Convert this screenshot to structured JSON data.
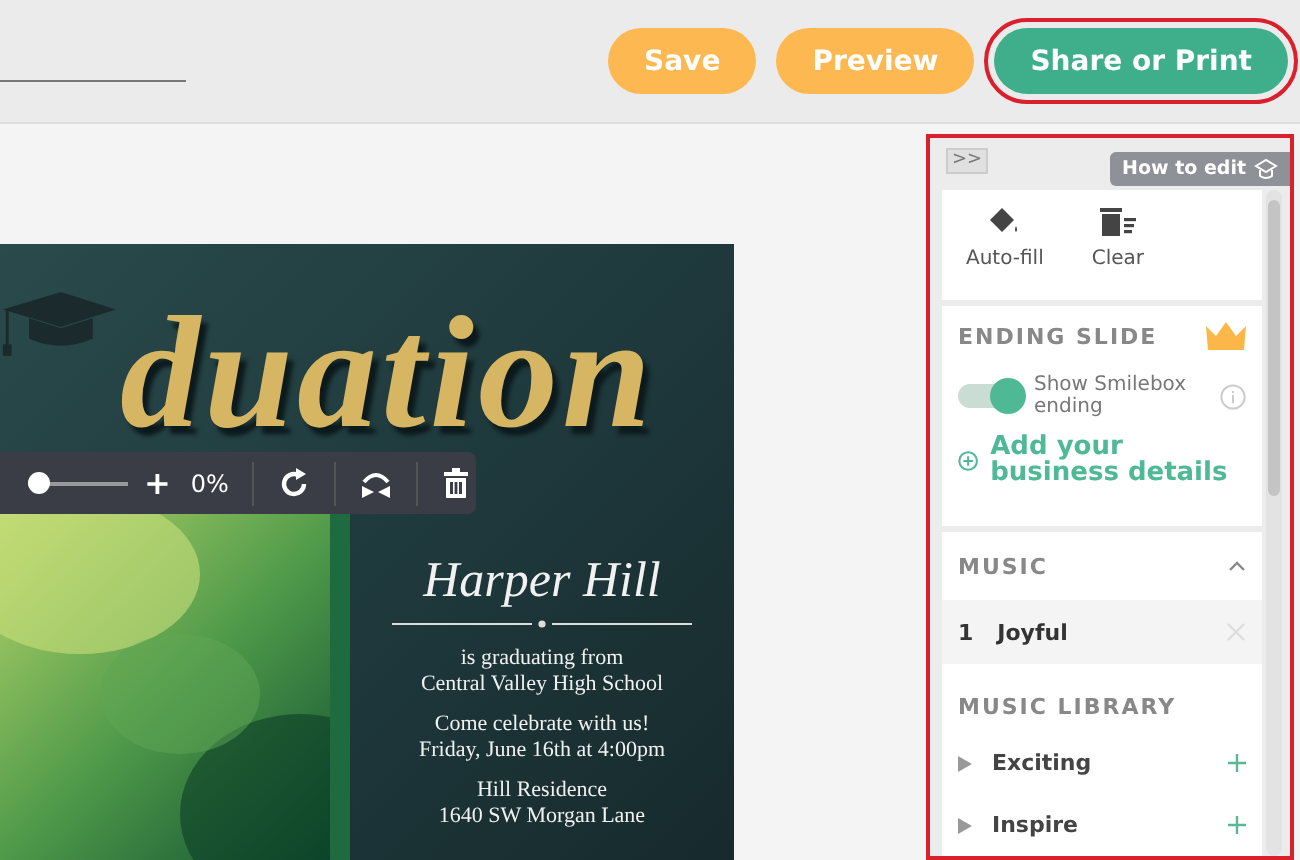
{
  "top_bar": {
    "buttons": [
      {
        "label": "Save",
        "kind": "secondary",
        "highlighted": false
      },
      {
        "label": "Preview",
        "kind": "secondary",
        "highlighted": false
      },
      {
        "label": "Share or Print",
        "kind": "primary",
        "highlighted": true
      }
    ]
  },
  "card": {
    "title": "duation",
    "image_toolbar": {
      "plus": "+",
      "zoom": {
        "level": 0
      },
      "reading": "0%"
    },
    "name": "Harper Hill",
    "paragraphs": [
      [
        "is graduating from",
        "Central Valley High School"
      ],
      [
        "Come celebrate with us!",
        "Friday, June 16th at 4:00pm"
      ],
      [
        "Hill Residence",
        "1640 SW Morgan Lane"
      ]
    ]
  },
  "panel": {
    "highlighted": true,
    "collapse": ">>",
    "help": "How to edit",
    "tools": [
      {
        "label": "Auto-fill",
        "kind": "fill"
      },
      {
        "label": "Clear",
        "kind": "clear"
      }
    ],
    "ending_slide": {
      "title": "ENDING SLIDE",
      "toggle": {
        "label": "Show Smilebox ending",
        "on": true
      },
      "add_link": "Add your business details"
    },
    "music": {
      "title": "MUSIC",
      "expanded": true,
      "tracks": [
        {
          "number": "1",
          "name": "Joyful"
        }
      ],
      "library_title": "MUSIC LIBRARY",
      "library": [
        "Exciting",
        "Inspire"
      ]
    }
  }
}
